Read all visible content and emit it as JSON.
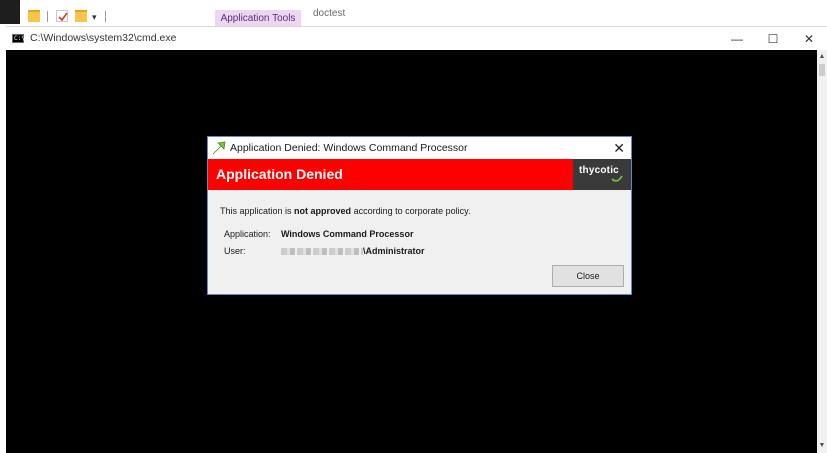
{
  "ribbon": {
    "context_tab": "Application Tools",
    "document_title": "doctest"
  },
  "cmd_window": {
    "title": "C:\\Windows\\system32\\cmd.exe",
    "minimize": "—",
    "maximize": "☐",
    "close": "✕"
  },
  "dialog": {
    "title": "Application Denied: Windows Command Processor",
    "close_glyph": "✕",
    "banner": "Application Denied",
    "logo": "thycotic",
    "message_pre": "This application is ",
    "message_bold": "not approved",
    "message_post": " according to corporate policy.",
    "application_label": "Application:",
    "application_value": "Windows Command Processor",
    "user_label": "User:",
    "user_value": "\\Administrator",
    "close_button": "Close"
  },
  "colors": {
    "banner": "#ff0000",
    "logo_bg": "#3a3a3a",
    "context_tab": "#eed6f3",
    "accent_green": "#7ac143"
  }
}
